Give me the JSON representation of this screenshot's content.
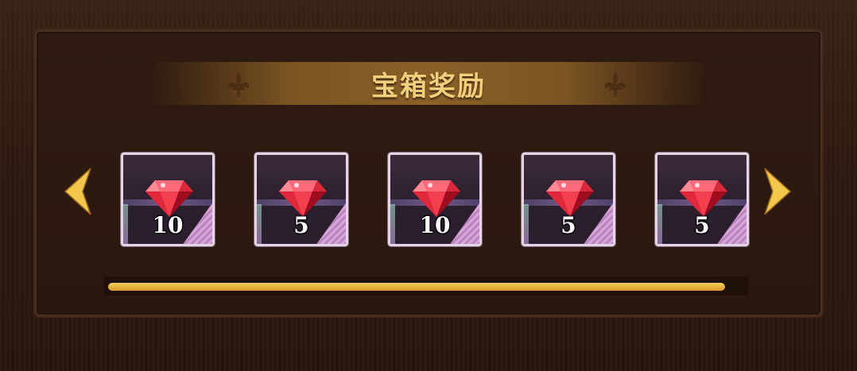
{
  "title": "宝箱奖励",
  "nav": {
    "prev_icon": "chevron-left-icon",
    "next_icon": "chevron-right-icon"
  },
  "rewards": [
    {
      "item": "ruby-gem",
      "quantity": "10"
    },
    {
      "item": "ruby-gem",
      "quantity": "5"
    },
    {
      "item": "ruby-gem",
      "quantity": "10"
    },
    {
      "item": "ruby-gem",
      "quantity": "5"
    },
    {
      "item": "ruby-gem",
      "quantity": "5"
    }
  ],
  "progress": {
    "fraction": 0.97
  },
  "colors": {
    "title": "#f2cf7a",
    "accent_gold": "#e8b33a",
    "gem_red": "#e0283a"
  }
}
